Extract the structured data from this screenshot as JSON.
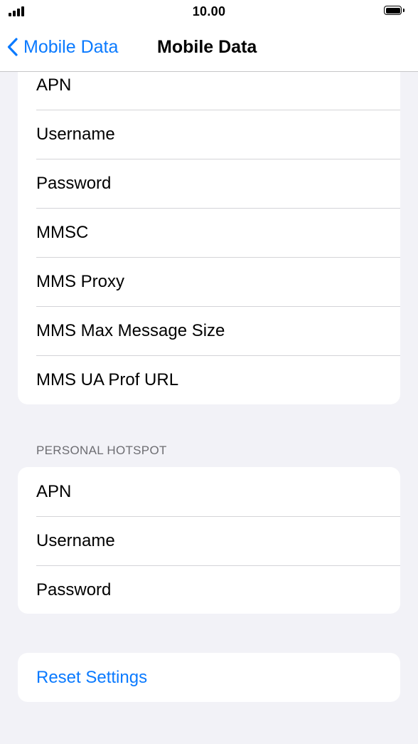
{
  "status_bar": {
    "time": "10.00"
  },
  "nav": {
    "back_label": "Mobile Data",
    "title": "Mobile Data"
  },
  "mobile_data_group": {
    "items": [
      {
        "label": "APN"
      },
      {
        "label": "Username"
      },
      {
        "label": "Password"
      },
      {
        "label": "MMSC"
      },
      {
        "label": "MMS Proxy"
      },
      {
        "label": "MMS Max Message Size"
      },
      {
        "label": "MMS UA Prof URL"
      }
    ]
  },
  "hotspot_group": {
    "header": "PERSONAL HOTSPOT",
    "items": [
      {
        "label": "APN"
      },
      {
        "label": "Username"
      },
      {
        "label": "Password"
      }
    ]
  },
  "reset": {
    "label": "Reset Settings"
  },
  "icons": {
    "signal": "cellular-signal-icon",
    "battery": "battery-full-icon",
    "back": "chevron-left-icon"
  },
  "colors": {
    "accent": "#0a7aff",
    "background": "#f2f2f7",
    "section_header": "#6d6d72"
  }
}
